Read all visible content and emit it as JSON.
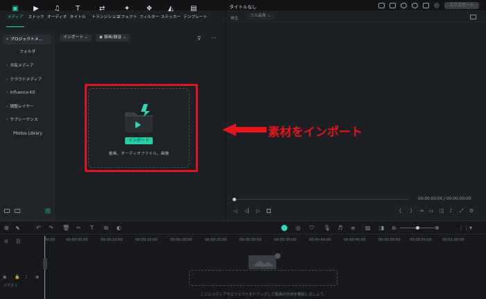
{
  "window": {
    "title": "タイトルなし",
    "export_label": "エクスポート"
  },
  "tabs": [
    {
      "label": "メディア",
      "icon": "media-icon"
    },
    {
      "label": "ストック",
      "icon": "stock-icon"
    },
    {
      "label": "オーディオ",
      "icon": "audio-icon"
    },
    {
      "label": "タイトル",
      "icon": "title-icon"
    },
    {
      "label": "トランジション",
      "icon": "transition-icon"
    },
    {
      "label": "エフェクト",
      "icon": "effect-icon"
    },
    {
      "label": "フィルター",
      "icon": "filter-icon"
    },
    {
      "label": "ステッカー",
      "icon": "sticker-icon"
    },
    {
      "label": "テンプレート",
      "icon": "template-icon"
    }
  ],
  "sidebar": {
    "items": [
      "プロジェクトメ...",
      "フォルダ",
      "共有メディア",
      "クラウドメディア",
      "Influence Kit",
      "調整レイヤー",
      "サブシーケンス",
      "Photos Library"
    ]
  },
  "media_toolbar": {
    "import_label": "インポート",
    "record_label": "録画/録音"
  },
  "dropzone": {
    "import_button": "インポート",
    "hint": "動画、オーディオファイル、画像"
  },
  "annotation": {
    "text": "素材をインポート"
  },
  "preview": {
    "play_label": "再生",
    "quality": "フル品質",
    "current_time": "00:00:00:00",
    "total_time": "00:00:00:00",
    "separator": "/"
  },
  "timeline": {
    "ticks": [
      "00:00",
      "00:00:05:00",
      "00:00:10:00",
      "00:00:15:00",
      "00:00:20:00",
      "00:00:25:00",
      "00:00:30:00",
      "00:00:35:00",
      "00:00:40:00",
      "00:00:45:00",
      "00:00:50:00",
      "00:00:55:00",
      "00:01:00:00"
    ],
    "track_label": "ビデオ 1",
    "hint": "ここにメディアやエフェクトをドラッグして動画の作成を開始しましょう。"
  },
  "colors": {
    "accent": "#2fd6b7",
    "annotation": "#e7141b"
  }
}
